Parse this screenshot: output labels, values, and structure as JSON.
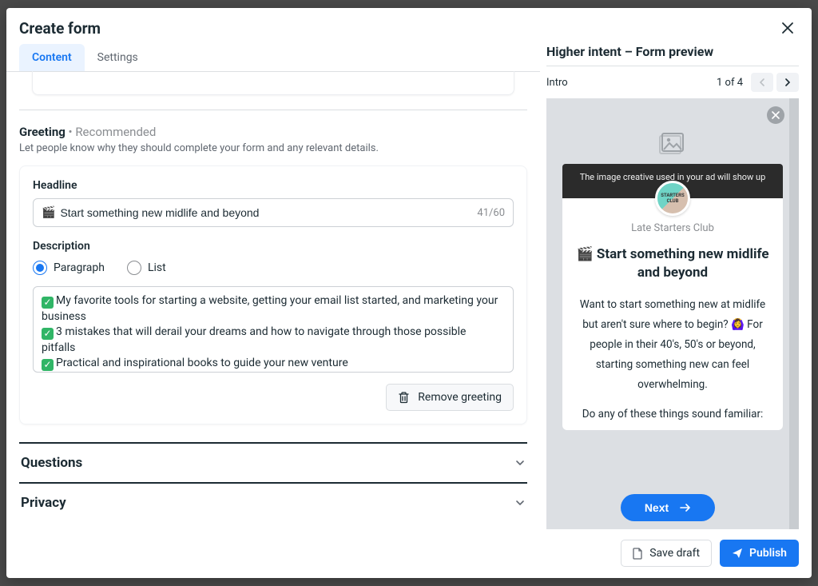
{
  "modal": {
    "title": "Create form",
    "tabs": {
      "content": "Content",
      "settings": "Settings"
    }
  },
  "greeting": {
    "title_bold": "Greeting",
    "title_rec": " • Recommended",
    "subtitle": "Let people know why they should complete your form and any relevant details.",
    "headline_label": "Headline",
    "headline_value": "Start something new midlife and beyond",
    "headline_count": "41/60",
    "desc_label": "Description",
    "radio_paragraph": "Paragraph",
    "radio_list": "List",
    "desc_line1": "My favorite tools for starting a website, getting your email list started, and marketing your business",
    "desc_line2": "3 mistakes that will derail your dreams and how to navigate through those possible pitfalls",
    "desc_line3": "Practical and inspirational books to guide your new venture",
    "remove_label": "Remove greeting"
  },
  "accordions": {
    "questions": "Questions",
    "privacy": "Privacy"
  },
  "preview": {
    "title": "Higher intent – Form preview",
    "step_label": "Intro",
    "pager": "1 of 4",
    "ad_note": "The image creative used in your ad will show up",
    "brand": "Late Starters Club",
    "headline": "🎬 Start something new midlife and beyond",
    "body": "Want to start something new at midlife but aren't sure where to begin? 🙆‍♀️ For people in their 40's, 50's or beyond, starting something new can feel overwhelming.",
    "body2": "Do any of these things sound familiar:",
    "next": "Next"
  },
  "footer": {
    "save": "Save draft",
    "publish": "Publish"
  }
}
